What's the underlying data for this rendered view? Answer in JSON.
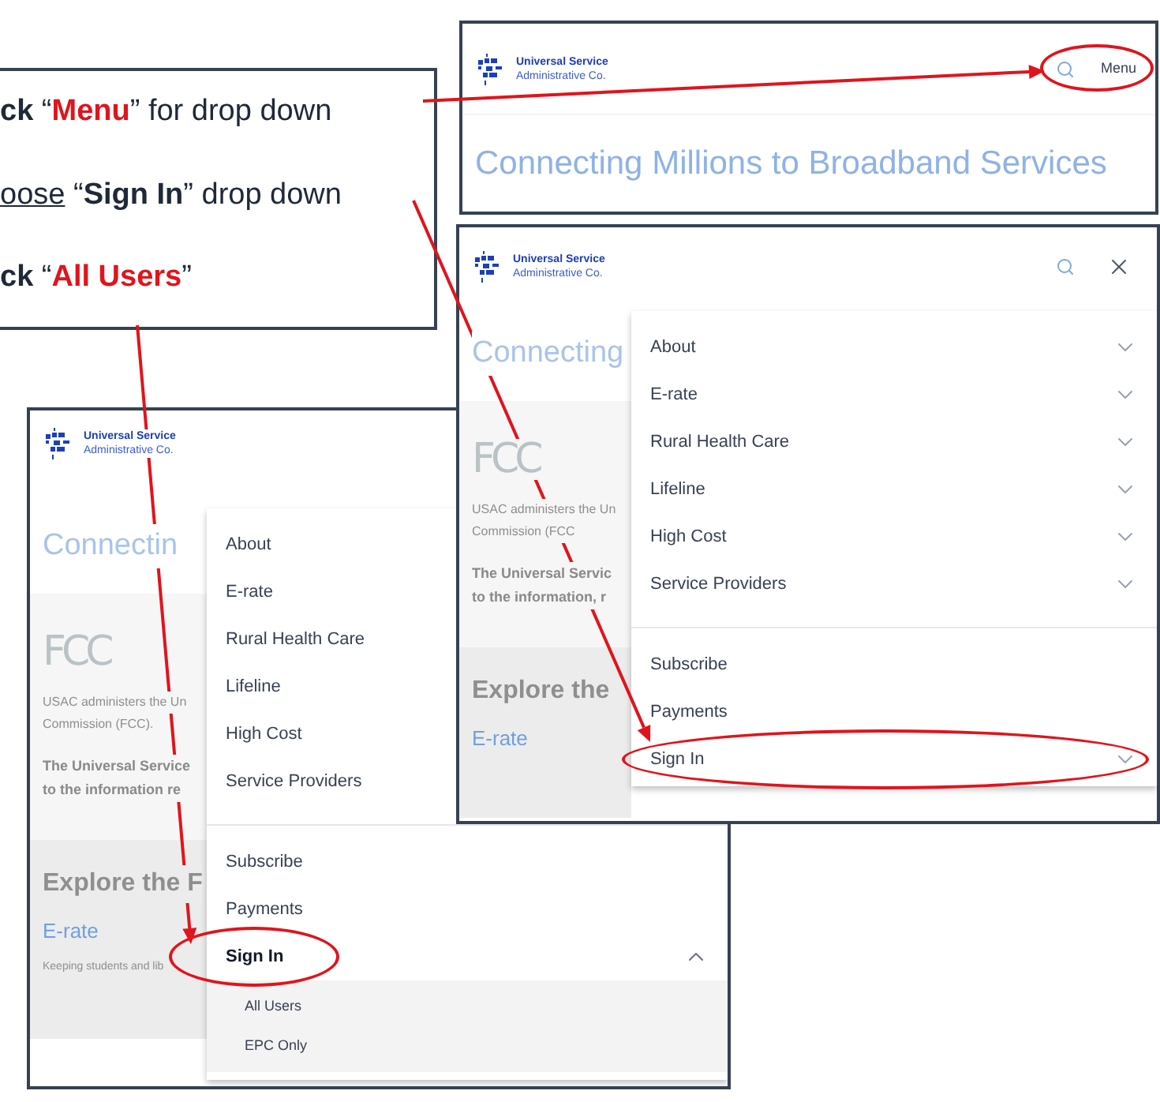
{
  "instructions": [
    {
      "parts": [
        {
          "text": "ck",
          "kind": "bold"
        },
        {
          "text": " “",
          "kind": "plain"
        },
        {
          "text": "Menu",
          "kind": "red"
        },
        {
          "text": "” for drop down",
          "kind": "plain"
        }
      ]
    },
    {
      "parts": [
        {
          "text": "oose",
          "kind": "underline"
        },
        {
          "text": " “",
          "kind": "plain"
        },
        {
          "text": "Sign In",
          "kind": "bold"
        },
        {
          "text": "” drop down",
          "kind": "plain"
        }
      ]
    },
    {
      "parts": [
        {
          "text": "ck",
          "kind": "bold"
        },
        {
          "text": " “",
          "kind": "plain"
        },
        {
          "text": "All Users",
          "kind": "red"
        },
        {
          "text": "”",
          "kind": "plain"
        }
      ]
    }
  ],
  "screens": [
    {
      "kind": "lower",
      "logo": [
        "Universal Service",
        "Administrative Co."
      ],
      "heading": "Connectin",
      "fcc_logo": "FCC",
      "intro": [
        "USAC administers the Un",
        "Commission (FCC)."
      ],
      "body": [
        "The Universal Service",
        "to the information re"
      ],
      "explore": "Explore the F",
      "link": "E-rate",
      "link_caption": "Keeping students and lib",
      "menu": {
        "sections": [
          {
            "label": "About"
          },
          {
            "label": "E-rate"
          },
          {
            "label": "Rural Health Care"
          },
          {
            "label": "Lifeline"
          },
          {
            "label": "High Cost"
          },
          {
            "label": "Service Providers"
          }
        ],
        "links": [
          "Subscribe",
          "Payments"
        ],
        "sign_in": {
          "label": "Sign In",
          "expanded": true,
          "highlighted": true,
          "children": [
            "All Users",
            "EPC Only"
          ]
        }
      }
    },
    {
      "kind": "upper",
      "logo": [
        "Universal Service",
        "Administrative Co."
      ],
      "menu_button": {
        "label": "Menu",
        "highlighted": true
      },
      "heading": "Connecting Millions to Broadband Services"
    },
    {
      "kind": "middle",
      "logo": [
        "Universal Service",
        "Administrative Co."
      ],
      "close_button": true,
      "section_chevrons": true,
      "heading": "Connecting",
      "fcc_logo": "FCC",
      "intro": [
        "USAC administers the Un",
        "Commission (FCC"
      ],
      "body": [
        "The Universal Servic",
        "to the information, r"
      ],
      "explore": "Explore the",
      "link": "E-rate",
      "menu": {
        "sections": [
          {
            "label": "About"
          },
          {
            "label": "E-rate"
          },
          {
            "label": "Rural Health Care"
          },
          {
            "label": "Lifeline"
          },
          {
            "label": "High Cost"
          },
          {
            "label": "Service Providers"
          }
        ],
        "links": [
          "Subscribe",
          "Payments"
        ],
        "sign_in": {
          "label": "Sign In",
          "expanded": false,
          "highlighted": true
        }
      }
    }
  ]
}
